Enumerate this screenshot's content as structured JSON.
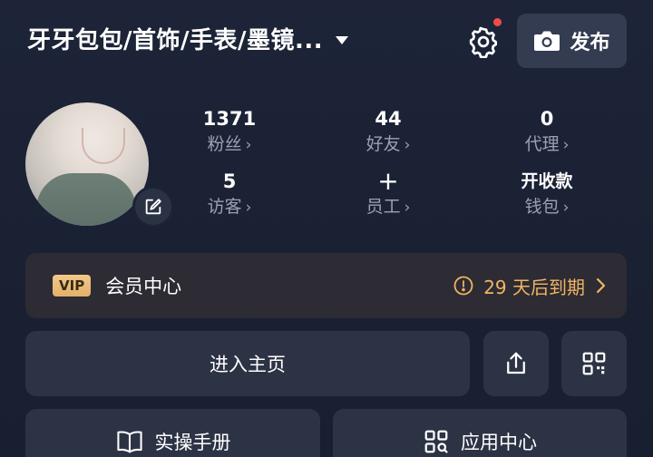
{
  "header": {
    "title": "牙牙包包/首饰/手表/墨镜...",
    "publish_label": "发布"
  },
  "stats": [
    {
      "value": "1371",
      "label": "粉丝"
    },
    {
      "value": "44",
      "label": "好友"
    },
    {
      "value": "0",
      "label": "代理"
    },
    {
      "value": "5",
      "label": "访客"
    },
    {
      "value": "+",
      "label": "员工"
    },
    {
      "value": "开收款",
      "label": "钱包"
    }
  ],
  "vip": {
    "tag": "VIP",
    "title": "会员中心",
    "expire": "29 天后到期"
  },
  "actions": {
    "home": "进入主页",
    "manual": "实操手册",
    "apps": "应用中心"
  },
  "colors": {
    "accent_gold": "#f0b463",
    "badge_red": "#f04b4b"
  },
  "icons": [
    "settings-icon",
    "camera-icon",
    "edit-icon",
    "share-icon",
    "qrcode-icon",
    "book-icon",
    "grid-search-icon",
    "clock-warning-icon",
    "chevron-right-icon"
  ]
}
